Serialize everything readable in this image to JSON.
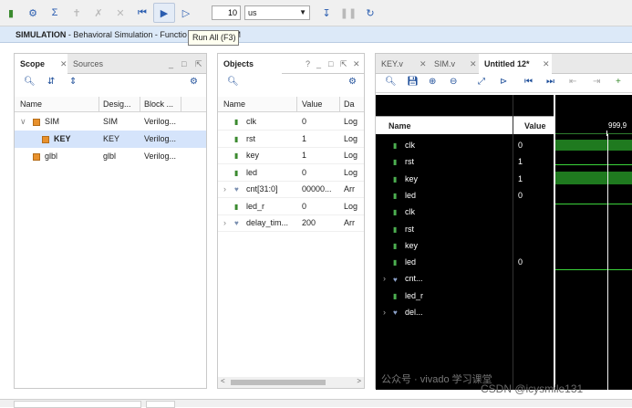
{
  "toolbar": {
    "icons": [
      "settings-icon",
      "sigma-icon",
      "pin-icon",
      "scissors-icon",
      "close-icon",
      "restart-icon",
      "run-all-icon",
      "run-for-icon",
      "step-icon",
      "break-icon",
      "relaunch-icon"
    ],
    "time_value": "10",
    "time_unit": "us"
  },
  "sim_bar": {
    "title_bold": "SIMULATION",
    "title_rest": " - Behavioral Simulation - Functio",
    "title_tail": "IM"
  },
  "tooltip": "Run All (F3)",
  "scope_pane": {
    "tabs": [
      "Scope",
      "Sources"
    ],
    "columns": [
      "Name",
      "Desig...",
      "Block ..."
    ],
    "rows": [
      {
        "name": "SIM",
        "design": "SIM",
        "block": "Verilog..."
      },
      {
        "name": "KEY",
        "design": "KEY",
        "block": "Verilog..."
      },
      {
        "name": "glbl",
        "design": "glbl",
        "block": "Verilog..."
      }
    ]
  },
  "objects_pane": {
    "title": "Objects",
    "columns": [
      "Name",
      "Value",
      "Da"
    ],
    "rows": [
      {
        "name": "clk",
        "value": "0",
        "type": "Log"
      },
      {
        "name": "rst",
        "value": "1",
        "type": "Log"
      },
      {
        "name": "key",
        "value": "1",
        "type": "Log"
      },
      {
        "name": "led",
        "value": "0",
        "type": "Log"
      },
      {
        "name": "cnt[31:0]",
        "value": "00000...",
        "type": "Arr"
      },
      {
        "name": "led_r",
        "value": "0",
        "type": "Log"
      },
      {
        "name": "delay_tim...",
        "value": "200",
        "type": "Arr"
      }
    ]
  },
  "wave_pane": {
    "tabs": [
      "KEY.v",
      "SIM.v",
      "Untitled 12*"
    ],
    "columns": [
      "Name",
      "Value"
    ],
    "time_label": "999,9",
    "rows": [
      {
        "name": "clk",
        "value": "0"
      },
      {
        "name": "rst",
        "value": "1"
      },
      {
        "name": "key",
        "value": "1"
      },
      {
        "name": "led",
        "value": "0"
      },
      {
        "name": "clk",
        "value": ""
      },
      {
        "name": "rst",
        "value": ""
      },
      {
        "name": "key",
        "value": ""
      },
      {
        "name": "led",
        "value": "0"
      },
      {
        "name": "cnt...",
        "value": ""
      },
      {
        "name": "led_r",
        "value": ""
      },
      {
        "name": "del...",
        "value": ""
      }
    ]
  },
  "watermark": {
    "line1": "公众号 · vivado 学习课堂",
    "line2": "CSDN @icysmile131"
  }
}
